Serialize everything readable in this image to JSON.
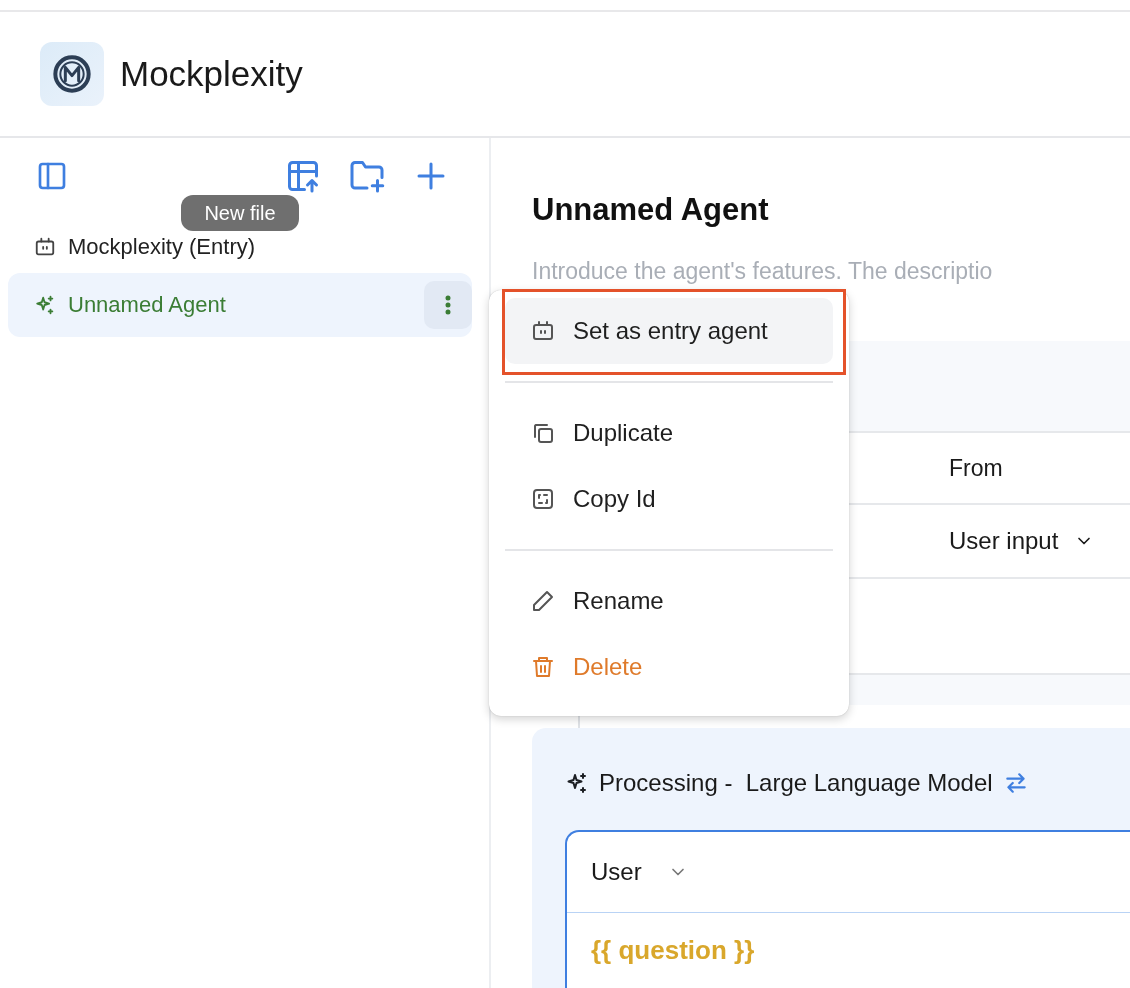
{
  "app": {
    "name": "Mockplexity"
  },
  "sidebar": {
    "tooltip": "New file",
    "items": [
      {
        "label": "Mockplexity (Entry)",
        "kind": "entry",
        "selected": false
      },
      {
        "label": "Unnamed Agent",
        "kind": "agent",
        "selected": true
      }
    ]
  },
  "agent": {
    "title": "Unnamed Agent",
    "description": {
      "placeholder": "Introduce the agent's features. The descriptio"
    },
    "input_table": {
      "from_heading": "From",
      "rows": [
        {
          "from": "User input"
        }
      ]
    },
    "processing": {
      "title": "Processing -  Large Language Model",
      "role": "User",
      "prompt": "{{ question }}"
    }
  },
  "context_menu": {
    "groups": [
      [
        {
          "label": "Set as entry agent",
          "kind": "normal",
          "highlighted": true,
          "outlined": true
        }
      ],
      [
        {
          "label": "Duplicate",
          "kind": "normal",
          "highlighted": false,
          "outlined": false
        },
        {
          "label": "Copy Id",
          "kind": "normal",
          "highlighted": false,
          "outlined": false
        }
      ],
      [
        {
          "label": "Rename",
          "kind": "normal",
          "highlighted": false,
          "outlined": false
        },
        {
          "label": "Delete",
          "kind": "danger",
          "highlighted": false,
          "outlined": false
        }
      ]
    ]
  }
}
